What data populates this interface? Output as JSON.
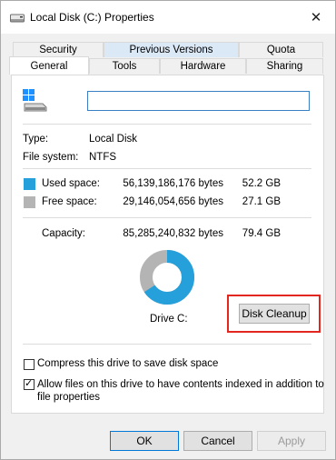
{
  "title": "Local Disk (C:) Properties",
  "close_glyph": "✕",
  "tabs_back": [
    "Security",
    "Previous Versions",
    "Quota"
  ],
  "tabs_front": [
    "General",
    "Tools",
    "Hardware",
    "Sharing"
  ],
  "drive_name_value": "",
  "type": {
    "label": "Type:",
    "value": "Local Disk"
  },
  "fs": {
    "label": "File system:",
    "value": "NTFS"
  },
  "used": {
    "label": "Used space:",
    "bytes": "56,139,186,176 bytes",
    "size": "52.2 GB",
    "color": "#26a0da",
    "fraction": 0.658
  },
  "free": {
    "label": "Free space:",
    "bytes": "29,146,054,656 bytes",
    "size": "27.1 GB",
    "color": "#b4b4b4"
  },
  "capacity": {
    "label": "Capacity:",
    "bytes": "85,285,240,832 bytes",
    "size": "79.4 GB"
  },
  "drive_label": "Drive C:",
  "disk_cleanup": "Disk Cleanup",
  "compress": {
    "label": "Compress this drive to save disk space",
    "checked": false
  },
  "index": {
    "label_line1": "Allow files on this drive to have contents indexed in addition to",
    "label_line2": "file properties",
    "checked": true,
    "check_glyph": "✓"
  },
  "buttons": {
    "ok": "OK",
    "cancel": "Cancel",
    "apply": "Apply"
  },
  "icons": [
    "hard-drive-icon",
    "close-icon",
    "checkmark-icon"
  ]
}
